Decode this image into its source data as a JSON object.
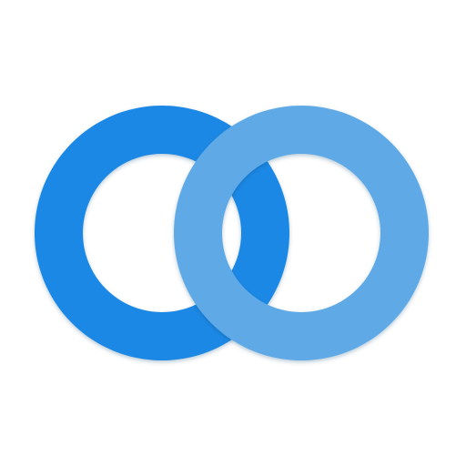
{
  "icon": {
    "semantic_name": "linked-rings-icon",
    "colors": {
      "background": "#ffffff",
      "left_ring": "#1e88e5",
      "right_ring": "#5faae6",
      "shadow": "#0d3f6e"
    }
  }
}
